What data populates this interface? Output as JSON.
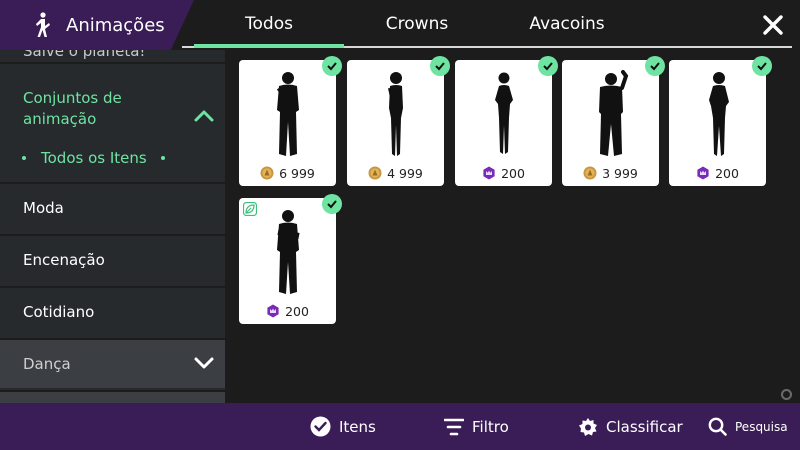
{
  "header": {
    "title": "Animações",
    "tabs": [
      {
        "label": "Todos",
        "active": true
      },
      {
        "label": "Crowns",
        "active": false
      },
      {
        "label": "Avacoins",
        "active": false
      }
    ],
    "close_icon": "close-icon"
  },
  "sidebar": {
    "cut_item": "Salve o planeta!",
    "expanded_category": "Conjuntos de animação",
    "sub_item": "Todos os Itens",
    "items": [
      {
        "label": "Moda"
      },
      {
        "label": "Encenação"
      },
      {
        "label": "Cotidiano"
      },
      {
        "label": "Dança"
      }
    ]
  },
  "items": [
    {
      "price": "6 999",
      "currency": "coin-gold",
      "owned": true
    },
    {
      "price": "4 999",
      "currency": "coin-gold",
      "owned": true
    },
    {
      "price": "200",
      "currency": "crown-purple",
      "owned": true
    },
    {
      "price": "3 999",
      "currency": "coin-gold",
      "owned": true
    },
    {
      "price": "200",
      "currency": "crown-purple",
      "owned": true
    },
    {
      "price": "200",
      "currency": "crown-purple",
      "owned": true,
      "tag": "eco-leaf-icon"
    }
  ],
  "bottombar": {
    "itens": "Itens",
    "filtro": "Filtro",
    "classificar": "Classificar",
    "pesquisa": "Pesquisa"
  },
  "colors": {
    "accent": "#6fe3a2",
    "purple": "#3a1d57",
    "gold": "#d4a24a",
    "crown": "#7a2bb5"
  }
}
